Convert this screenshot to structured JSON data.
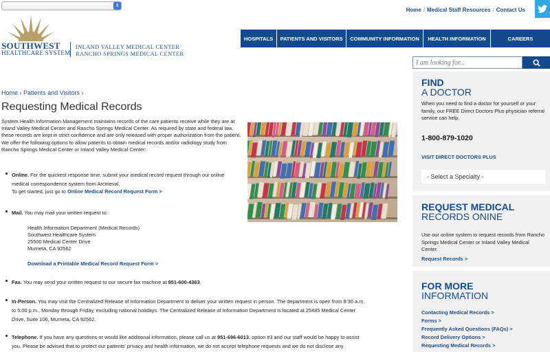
{
  "topbar": {
    "selector_value": "",
    "links": [
      "Home",
      "Medical Staff Resources",
      "Contact Us"
    ],
    "sep": "/"
  },
  "logo": {
    "brand_line1": "SOUTHWEST",
    "brand_line2": "HEALTHCARE SYSTEM",
    "hospital1": "INLAND VALLEY MEDICAL CENTER",
    "hospital2": "RANCHO SPRINGS MEDICAL CENTER"
  },
  "nav": [
    "HOSPITALS",
    "PATIENTS AND VISITORS",
    "COMMUNITY INFORMATION",
    "HEALTH INFORMATION",
    "CAREERS"
  ],
  "search": {
    "placeholder": "I am looking for..."
  },
  "breadcrumb": {
    "home": "Home",
    "sep": "›",
    "section": "Patients and Visitors"
  },
  "page_title": "Requesting Medical Records",
  "intro": "System Health Information Management maintains records of the care patients receive while they are at Inland Valley Medical Center and Rancho Springs Medical Center. As required by state and federal law, these records are kept in strict confidence and are only released with proper authorization from the patient. We offer the following options to allow patients to obtain medical records and/or radiology study from Rancho Springs Medical Center or Inland Valley Medical Center:",
  "options": {
    "online": {
      "label": "Online.",
      "text": "For the quickest response time, submit your medical record request through our online",
      "text2": "medical correspondence system from Arctrieval.",
      "text3": "To get started, just go to",
      "link": "Online Medical Record Request Form >"
    },
    "mail": {
      "label": "Mail.",
      "text": "You may mail your written request to:",
      "address": [
        "Health Information Department (Medical Records)",
        "Southwest Healthcare System",
        "25500 Medical Center Drive",
        "Murrieta, CA 92562"
      ],
      "link": "Download a Printable Medical Record Request Form >"
    },
    "fax": {
      "label": "Fax.",
      "text": "You may send your written request to our secure fax machine at",
      "number": "951-600-4363",
      "end": "."
    },
    "inperson": {
      "label": "In-Person.",
      "text": "You may visit the Centralized Release of Information Department to deliver your written request in person. The department is open from 8:30 a.m.",
      "text2": "to 5:00 p.m., Monday through Friday, excluding national holidays. The Centralized Release of Information Department is located at 25485 Medical Center",
      "text3": "Drive, Suite 106, Murrieta, CA 92562."
    },
    "telephone": {
      "label": "Telephone.",
      "text": "If you have any questions or would like additional information, please call us at",
      "number": "951-696-6013",
      "text_after": ", option #3 and our staff would be happy to assist",
      "text2": "you.  Please be advised that to protect our patients' privacy and health information, we do not accept telephone requests and we do not disclose any"
    }
  },
  "sidebar": {
    "find": {
      "title1": "FIND",
      "title2": "A DOCTOR",
      "text": "When you need to find a doctor for yourself or your family, our FREE Direct Doctors Plus physician referral service can help.",
      "phone": "1-800-879-1020",
      "link": "VISIT DIRECT DOCTORS PLUS",
      "specialty": "- Select a Specialty -"
    },
    "request": {
      "title1": "REQUEST MEDICAL",
      "title2": "RECORDS ONINE",
      "text": "Use our online system to request records from Rancho Springs Medical Center or Inland Valley Medical Center.",
      "link": "Request Records >"
    },
    "more": {
      "title1": "FOR MORE",
      "title2": "INFORMATION",
      "links": [
        "Contacting Medical Records >",
        "Forms >",
        "Frequently Asked Questions (FAQs) >",
        "Record Delivery Options >",
        "Requesting Medical Records >"
      ]
    }
  },
  "colors": {
    "primary": "#124a8d",
    "link": "#1c4e8a",
    "sun": "#b8a168",
    "twitter": "#2fa7e0"
  }
}
